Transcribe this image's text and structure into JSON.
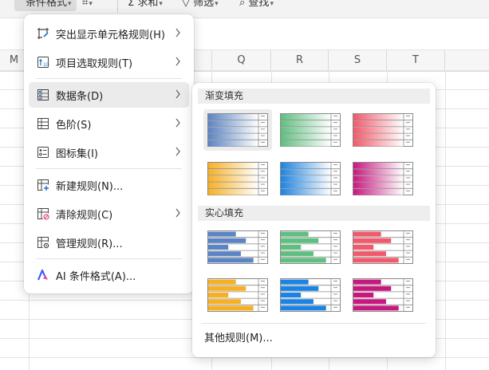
{
  "toolbar": {
    "active_label": "条件格式",
    "sort_label": "求和",
    "filter_label": "筛选",
    "find_label": "查找"
  },
  "columns": [
    "M",
    "Q",
    "R",
    "S",
    "T"
  ],
  "menu": {
    "items": [
      {
        "label": "突出显示单元格规则(H)",
        "icon": "highlight-cells-icon",
        "has_submenu": true
      },
      {
        "label": "项目选取规则(T)",
        "icon": "top-bottom-rules-icon",
        "has_submenu": true
      },
      {
        "label": "数据条(D)",
        "icon": "data-bars-icon",
        "has_submenu": true,
        "highlighted": true
      },
      {
        "label": "色阶(S)",
        "icon": "color-scales-icon",
        "has_submenu": true
      },
      {
        "label": "图标集(I)",
        "icon": "icon-sets-icon",
        "has_submenu": true
      },
      {
        "label": "新建规则(N)...",
        "icon": "new-rule-icon",
        "has_submenu": false
      },
      {
        "label": "清除规则(C)",
        "icon": "clear-rules-icon",
        "has_submenu": true
      },
      {
        "label": "管理规则(R)...",
        "icon": "manage-rules-icon",
        "has_submenu": false
      },
      {
        "label": "AI 条件格式(A)...",
        "icon": "ai-icon",
        "has_submenu": false
      }
    ]
  },
  "submenu": {
    "gradient_header": "渐变填充",
    "solid_header": "实心填充",
    "more_rules": "其他规则(M)...",
    "colors": [
      {
        "name": "blue",
        "hex": "#5b84c4"
      },
      {
        "name": "green",
        "hex": "#5fbf7f"
      },
      {
        "name": "red",
        "hex": "#f2596a"
      },
      {
        "name": "orange",
        "hex": "#f7b024"
      },
      {
        "name": "light-blue",
        "hex": "#1b83e3"
      },
      {
        "name": "purple",
        "hex": "#c8177e"
      }
    ],
    "bar_levels": [
      0.55,
      0.75,
      0.4,
      0.65,
      0.9
    ]
  }
}
